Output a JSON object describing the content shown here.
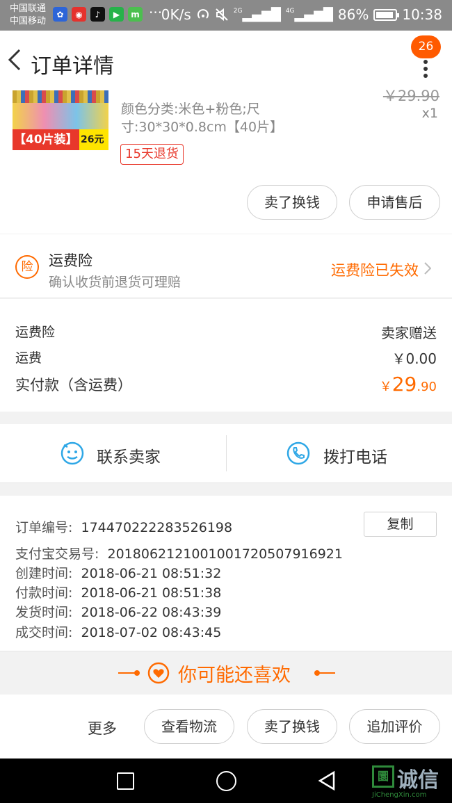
{
  "status_bar": {
    "carrier1": "中国联通",
    "carrier2": "中国移动",
    "apps": [
      "baidu",
      "weibo",
      "douyin",
      "video",
      "m"
    ],
    "more": "···",
    "speed": "0K/s",
    "net1": "2G",
    "net2": "4G",
    "battery": "86%",
    "time": "10:38"
  },
  "header": {
    "title": "订单详情",
    "badge": "26"
  },
  "product": {
    "promo_label": "【40片装】",
    "promo_price": "26元",
    "old_price": "￥29.90",
    "sku": "颜色分类:米色+粉色;尺寸:30*30*0.8cm【40片】",
    "qty": "x1",
    "return_tag": "15天退货",
    "sell_label": "卖了换钱",
    "after_sale_label": "申请售后"
  },
  "insurance": {
    "icon_text": "险",
    "title": "运费险",
    "subtitle": "确认收货前退货可理赔",
    "status": "运费险已失效"
  },
  "totals": {
    "insurance_label": "运费险",
    "insurance_value": "卖家赠送",
    "shipping_label": "运费",
    "shipping_value": "￥0.00",
    "paid_label": "实付款（含运费）",
    "paid_currency": "￥",
    "paid_integer": "29",
    "paid_decimal": ".90"
  },
  "contact": {
    "seller_label": "联系卖家",
    "phone_label": "拨打电话"
  },
  "order_info": {
    "order_no_label": "订单编号:",
    "order_no": "174470222283526198",
    "copy_label": "复制",
    "alipay_label": "支付宝交易号:",
    "alipay_no": "2018062121001001720507916921",
    "created_label": "创建时间:",
    "created": "2018-06-21 08:51:32",
    "paid_label": "付款时间:",
    "paid": "2018-06-21 08:51:38",
    "shipped_label": "发货时间:",
    "shipped": "2018-06-22 08:43:39",
    "done_label": "成交时间:",
    "done": "2018-07-02 08:43:45"
  },
  "recommend": {
    "title": "你可能还喜欢"
  },
  "action_bar": {
    "more_label": "更多",
    "logistics_label": "查看物流",
    "sell_label": "卖了换钱",
    "review_label": "追加评价"
  },
  "watermark": {
    "box_char": "圜",
    "text": "诚信",
    "sub": "JiChengXin.com"
  },
  "colors": {
    "accent": "#ff6a00",
    "badge": "#ff5a00",
    "return_red": "#e8382b",
    "contact_blue": "#2ea7e6"
  }
}
